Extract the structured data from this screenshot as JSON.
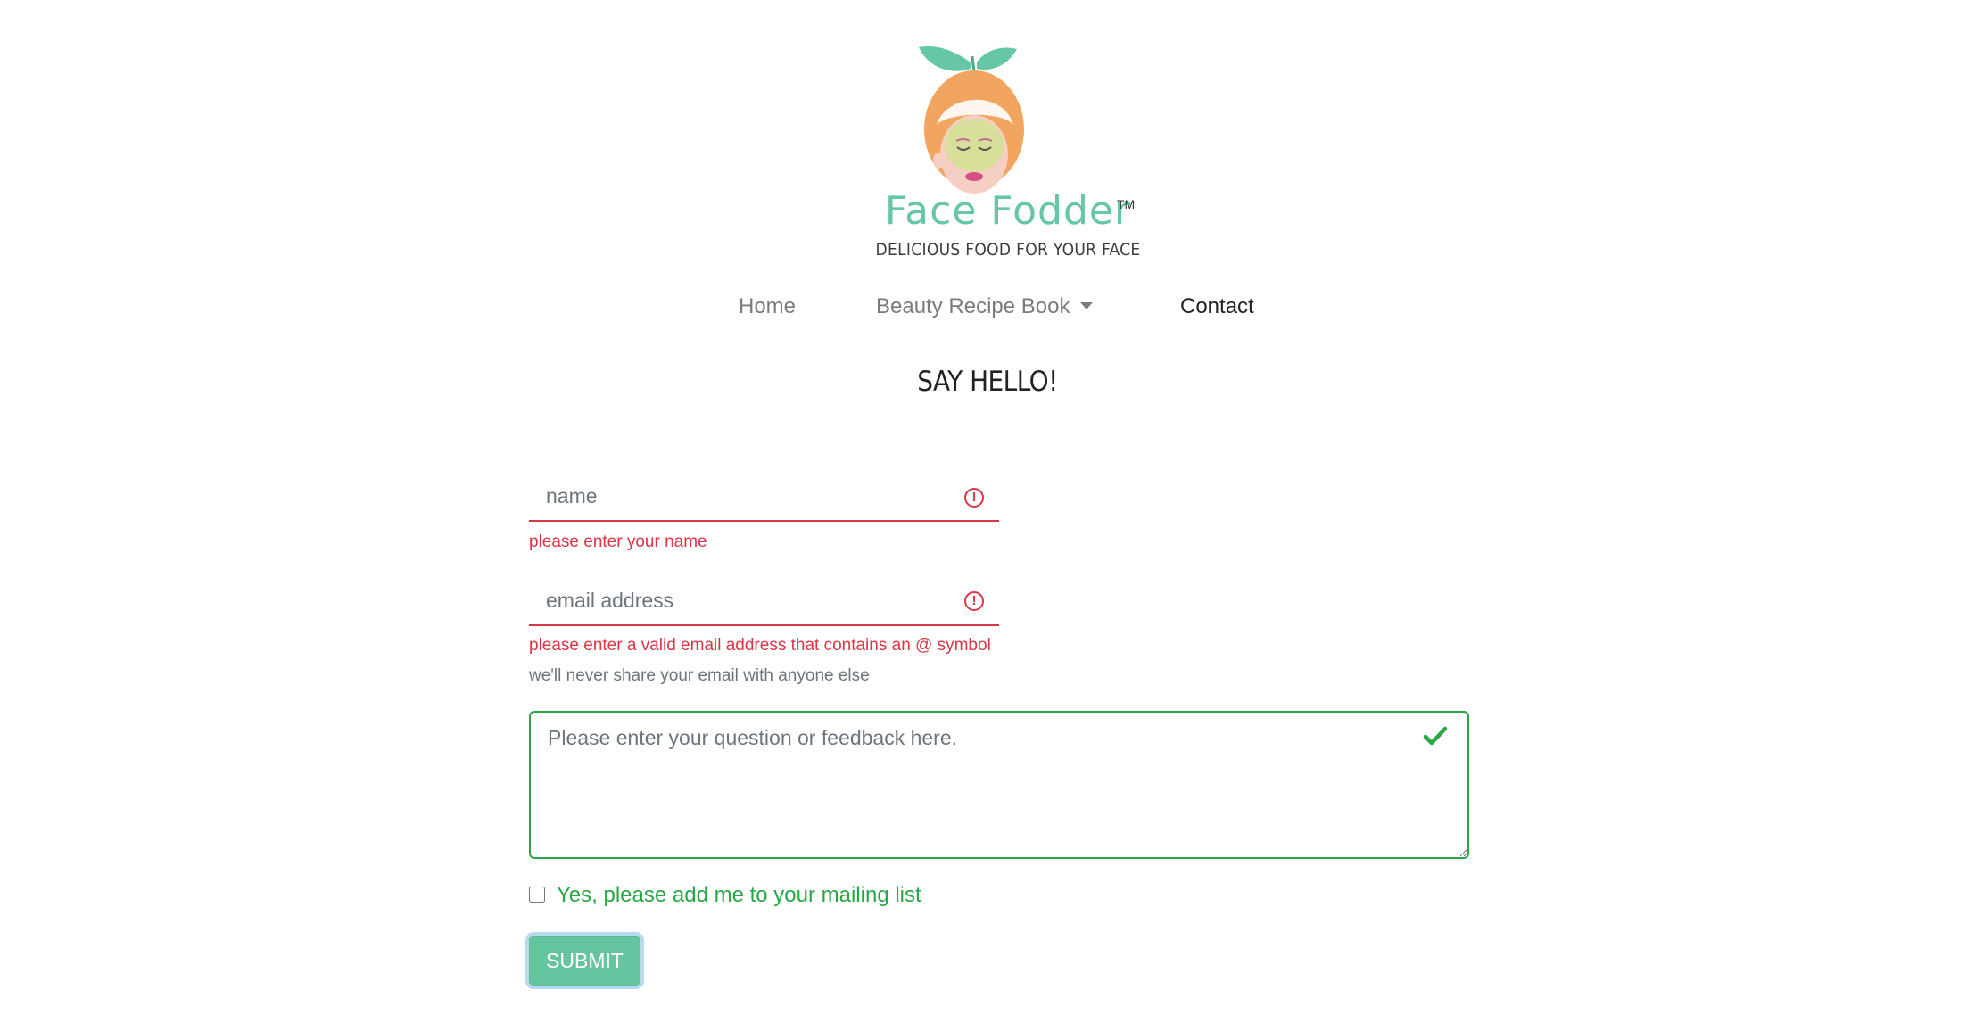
{
  "brand": {
    "name": "Face Fodder",
    "trademark": "TM",
    "tagline": "DELICIOUS FOOD FOR YOUR FACE"
  },
  "nav": {
    "items": [
      {
        "label": "Home"
      },
      {
        "label": "Beauty Recipe Book"
      },
      {
        "label": "Contact"
      }
    ]
  },
  "page": {
    "heading": "SAY HELLO!"
  },
  "form": {
    "name": {
      "placeholder": "name",
      "value": "",
      "error": "please enter your name"
    },
    "email": {
      "placeholder": "email address",
      "value": "",
      "error": "please enter a valid email address that contains an @ symbol",
      "help": "we'll never share your email with anyone else"
    },
    "message": {
      "placeholder": "Please enter your question or feedback here.",
      "value": ""
    },
    "mailing_list": {
      "label": "Yes, please add me to your mailing list",
      "checked": false
    },
    "submit_label": "SUBMIT"
  },
  "colors": {
    "brand": "#65c7a5",
    "error": "#dc3545",
    "success": "#28a745",
    "submit_bg": "#65c59f"
  },
  "icons": {
    "logo": "face-mask-peach-logo",
    "field_error": "exclamation-circle-icon",
    "field_valid": "check-icon",
    "dropdown": "caret-down-icon"
  }
}
